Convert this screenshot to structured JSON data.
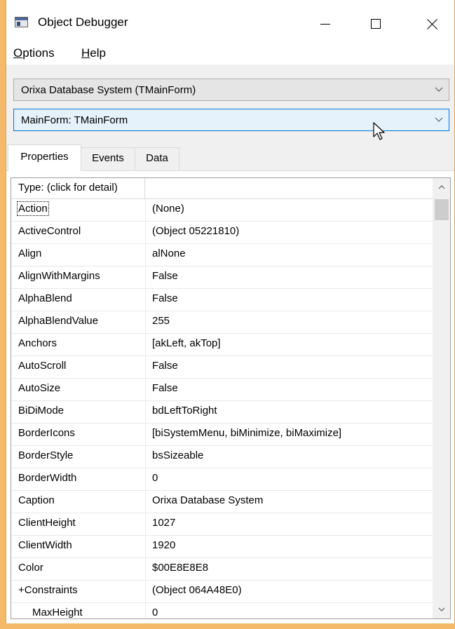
{
  "window": {
    "title": "Object Debugger"
  },
  "menu": [
    {
      "label_rest": "ptions",
      "label_u": "O"
    },
    {
      "label_rest": "elp",
      "label_u": "H"
    }
  ],
  "combos": {
    "application": "Orixa Database System (TMainForm)",
    "object": "MainForm: TMainForm"
  },
  "tabs": [
    "Properties",
    "Events",
    "Data"
  ],
  "grid": {
    "header": "Type: (click for detail)",
    "rows": [
      {
        "name": "Action",
        "value": "(None)"
      },
      {
        "name": "ActiveControl",
        "value": "(Object 05221810)"
      },
      {
        "name": "Align",
        "value": "alNone"
      },
      {
        "name": "AlignWithMargins",
        "value": "False"
      },
      {
        "name": "AlphaBlend",
        "value": "False"
      },
      {
        "name": "AlphaBlendValue",
        "value": "255"
      },
      {
        "name": "Anchors",
        "value": "[akLeft, akTop]"
      },
      {
        "name": "AutoScroll",
        "value": "False"
      },
      {
        "name": "AutoSize",
        "value": "False"
      },
      {
        "name": "BiDiMode",
        "value": "bdLeftToRight"
      },
      {
        "name": "BorderIcons",
        "value": "[biSystemMenu, biMinimize, biMaximize]"
      },
      {
        "name": "BorderStyle",
        "value": "bsSizeable"
      },
      {
        "name": "BorderWidth",
        "value": "0"
      },
      {
        "name": "Caption",
        "value": "Orixa Database System"
      },
      {
        "name": "ClientHeight",
        "value": "1027"
      },
      {
        "name": "ClientWidth",
        "value": "1920"
      },
      {
        "name": "Color",
        "value": "$00E8E8E8"
      },
      {
        "name": "+Constraints",
        "value": "(Object 064A48E0)"
      },
      {
        "name": "MaxHeight",
        "value": "0"
      }
    ]
  },
  "icons": {
    "app": "object-debugger-app-icon",
    "minimize": "minimize-icon",
    "maximize": "maximize-icon",
    "close": "close-icon",
    "dropdown": "chevron-down-icon",
    "scroll_up": "chevron-up-icon",
    "scroll_down": "chevron-down-icon",
    "cursor": "mouse-pointer-icon"
  },
  "colors": {
    "desktop": "#f5b96a",
    "window_border": "#e5a04f",
    "active_combo_border": "#0078d7",
    "active_combo_bg": "#e5f1fb"
  }
}
